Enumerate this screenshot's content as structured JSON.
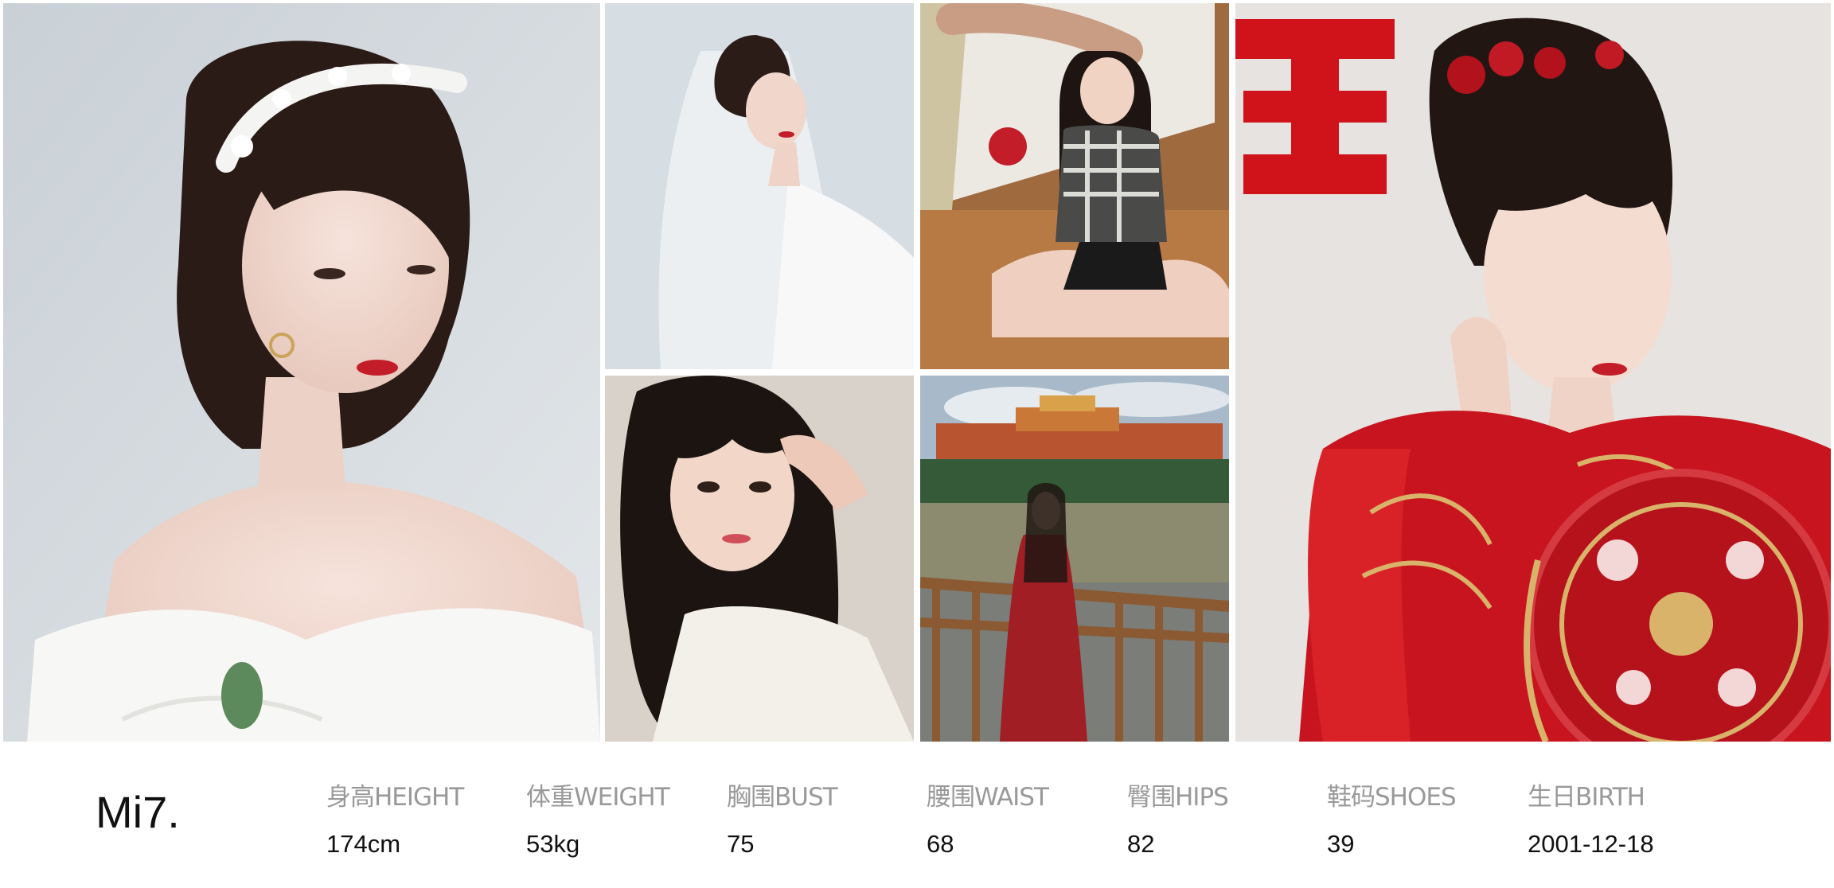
{
  "model": {
    "name": "Mi7."
  },
  "stats": [
    {
      "label": "身高HEIGHT",
      "value": "174cm"
    },
    {
      "label": "体重WEIGHT",
      "value": "53kg"
    },
    {
      "label": "胸围BUST",
      "value": "75"
    },
    {
      "label": "腰围WAIST",
      "value": "68"
    },
    {
      "label": "臀围HIPS",
      "value": "82"
    },
    {
      "label": "鞋码SHOES",
      "value": "39"
    },
    {
      "label": "生日BIRTH",
      "value": "2001-12-18"
    }
  ],
  "photos": [
    {
      "icon": "bridal-portrait-photo"
    },
    {
      "icon": "veil-portrait-photo"
    },
    {
      "icon": "plaid-shirt-floor-photo"
    },
    {
      "icon": "selfie-photo"
    },
    {
      "icon": "temple-outdoor-photo"
    },
    {
      "icon": "red-dress-fan-photo"
    }
  ],
  "colors": {
    "label": "#999999",
    "value": "#111111",
    "accent_red": "#c8141e"
  }
}
